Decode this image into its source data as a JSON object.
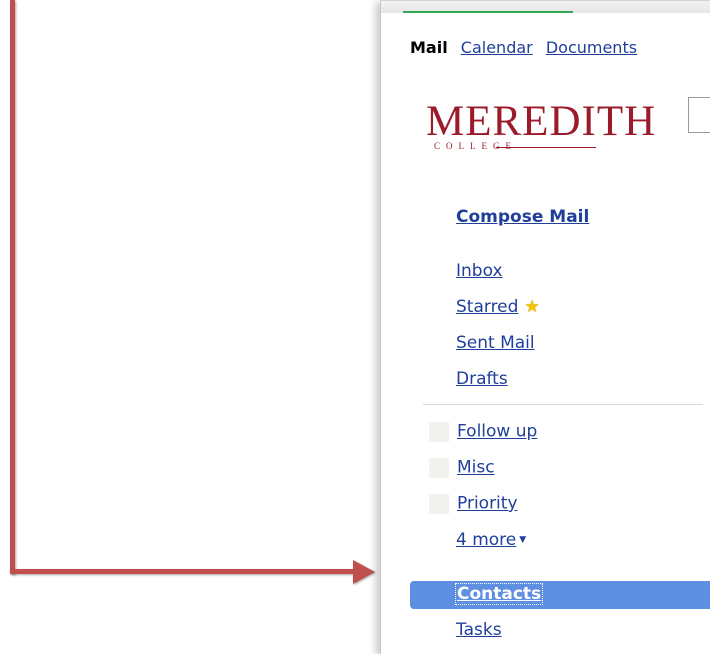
{
  "topnav": {
    "current": "Mail",
    "links": [
      "Calendar",
      "Documents"
    ]
  },
  "logo": {
    "word": "MEREDITH",
    "sub": "COLLEGE"
  },
  "compose": "Compose Mail",
  "system_labels": [
    "Inbox",
    "Starred",
    "Sent Mail",
    "Drafts"
  ],
  "labels": [
    "Follow up",
    "Misc",
    "Priority"
  ],
  "more": "4 more",
  "selected_item": "Contacts",
  "tasks": "Tasks",
  "icons": {
    "star": "star-icon",
    "dropdown": "chevron-down-icon"
  },
  "colors": {
    "arrow": "#c0504d",
    "link": "#1f3f9a",
    "brand": "#9b1b2a",
    "selected": "#5e8fe0"
  }
}
